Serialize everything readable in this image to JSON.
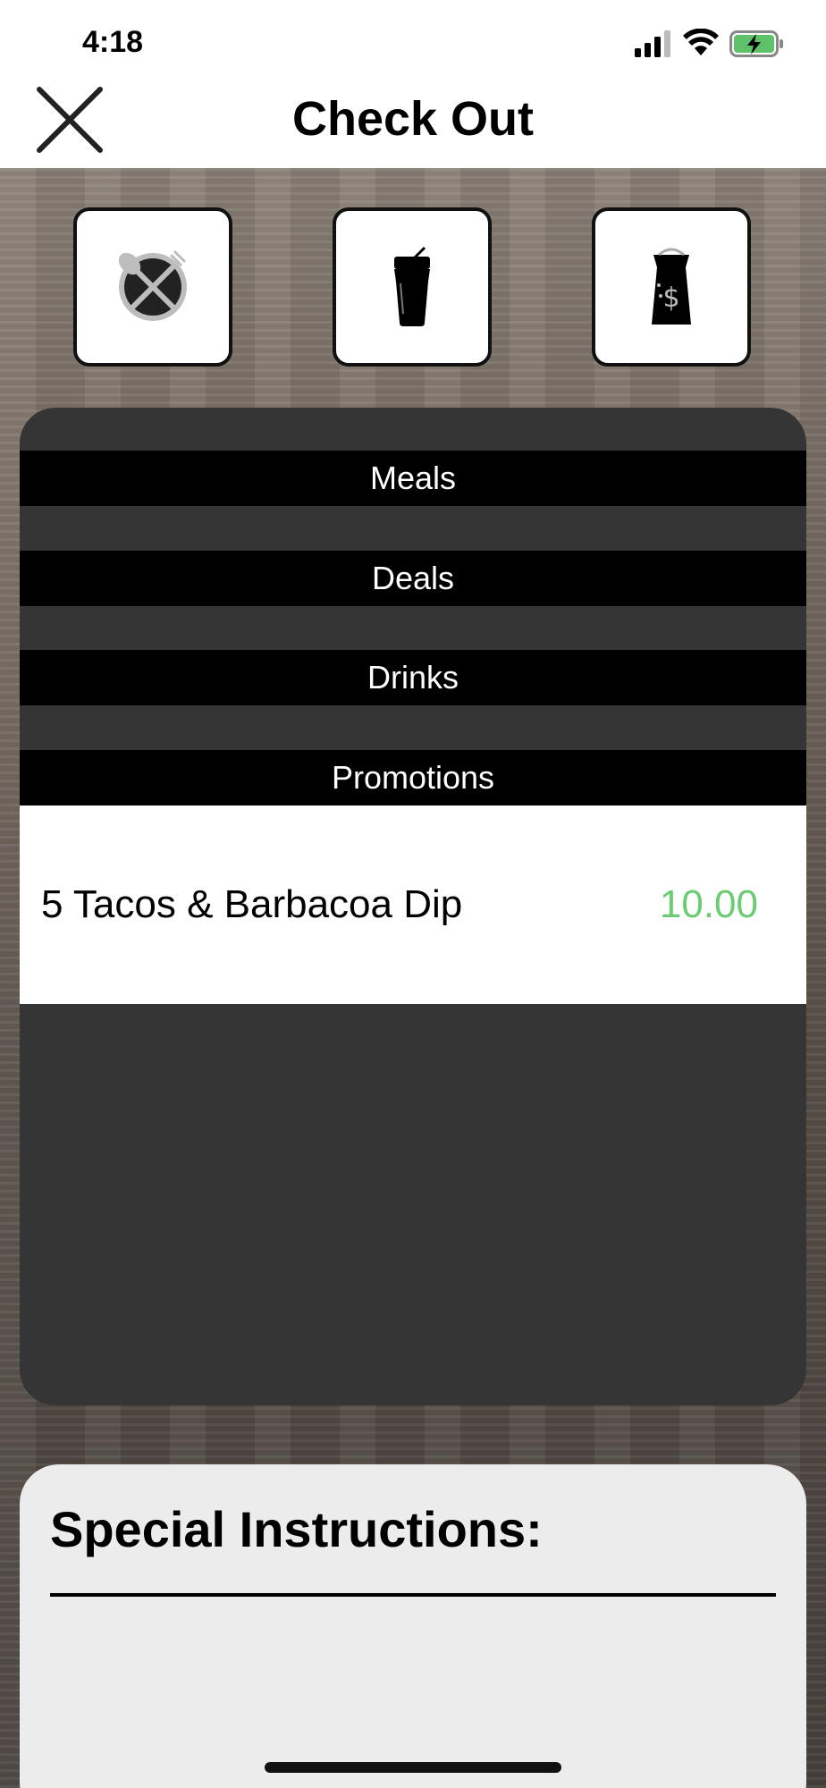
{
  "status_bar": {
    "time": "4:18"
  },
  "nav": {
    "title": "Check Out"
  },
  "category_tiles": [
    {
      "icon": "plate-fork-spoon-icon"
    },
    {
      "icon": "drink-cup-icon"
    },
    {
      "icon": "money-bag-icon"
    }
  ],
  "menu": {
    "sections": [
      "Meals",
      "Deals",
      "Drinks",
      "Promotions"
    ],
    "items": [
      {
        "name": "5 Tacos & Barbacoa Dip",
        "price": "10.00"
      }
    ]
  },
  "instructions": {
    "title": "Special Instructions:"
  },
  "colors": {
    "price": "#6ccc73",
    "section_bar": "#000000",
    "panel": "#353535",
    "battery": "#5ec26a"
  }
}
